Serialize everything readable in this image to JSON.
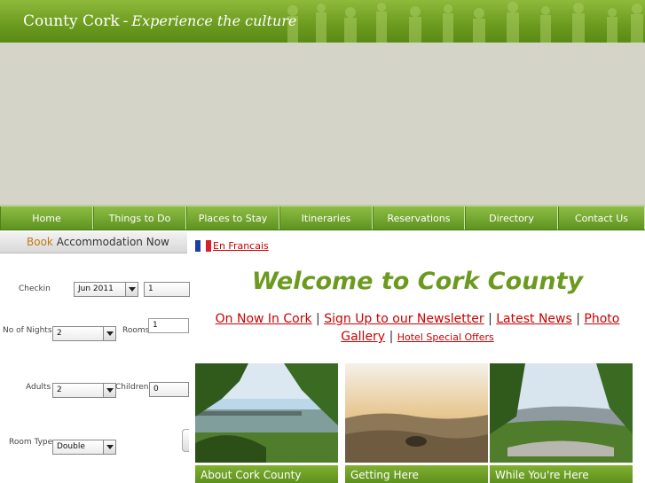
{
  "header": {
    "site_name": "County Cork",
    "separator": "-",
    "tagline": "Experience the culture"
  },
  "nav": {
    "items": [
      {
        "label": "Home",
        "name": "nav-home"
      },
      {
        "label": "Things to Do",
        "name": "nav-things-to-do"
      },
      {
        "label": "Places to Stay",
        "name": "nav-places-to-stay"
      },
      {
        "label": "Itineraries",
        "name": "nav-itineraries"
      },
      {
        "label": "Reservations",
        "name": "nav-reservations"
      },
      {
        "label": "Directory",
        "name": "nav-directory"
      },
      {
        "label": "Contact Us",
        "name": "nav-contact-us"
      }
    ]
  },
  "booking": {
    "title_accent": "Book",
    "title_rest": "Accommodation Now",
    "checkin_label": "Checkin",
    "checkin_month": "Jun 2011",
    "checkin_day": "1",
    "nights_label": "No of Nights",
    "nights_value": "2",
    "rooms_label": "Rooms",
    "rooms_value": "1",
    "adults_label": "Adults",
    "adults_value": "2",
    "children_label": "Children",
    "children_value": "0",
    "room_type_label": "Room Type",
    "room_type_value": "Double"
  },
  "main": {
    "language_link": "En Francais",
    "welcome": "Welcome to Cork County",
    "links": {
      "on_now": "On Now In Cork",
      "newsletter": "Sign Up to our Newsletter",
      "news": "Latest News",
      "gallery": "Photo Gallery",
      "hotel_offers": "Hotel Special Offers",
      "divider": "|"
    },
    "cards": [
      {
        "caption": "About Cork County"
      },
      {
        "caption": "Getting Here"
      },
      {
        "caption": "While You're Here"
      }
    ]
  },
  "colors": {
    "brand_green": "#6b9a1e",
    "link_red": "#cc0000",
    "accent_orange": "#c07a10"
  }
}
